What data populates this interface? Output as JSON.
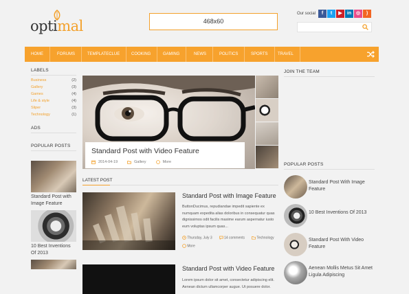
{
  "header": {
    "logo_part1": "opti",
    "logo_part2": "mal",
    "ad_text": "468x60",
    "social_label": "Our social",
    "social_icons": [
      {
        "name": "facebook-icon",
        "glyph": "f",
        "color": "#3b5998"
      },
      {
        "name": "twitter-icon",
        "glyph": "t",
        "color": "#1da1f2"
      },
      {
        "name": "youtube-icon",
        "glyph": "▶",
        "color": "#cc2127"
      },
      {
        "name": "linkedin-icon",
        "glyph": "in",
        "color": "#0077b5"
      },
      {
        "name": "dribbble-icon",
        "glyph": "◎",
        "color": "#ea4c89"
      },
      {
        "name": "rss-icon",
        "glyph": ")",
        "color": "#f26522"
      }
    ],
    "accent": "#f7a22d"
  },
  "nav": {
    "items": [
      "HOME",
      "FORUMS",
      "TEMPLATECLUE",
      "COOKING",
      "GAMING",
      "NEWS",
      "POLITICS",
      "SPORTS",
      "TRAVEL"
    ]
  },
  "left_sidebar": {
    "labels_title": "LABELS",
    "labels": [
      {
        "name": "Business",
        "count": "(2)"
      },
      {
        "name": "Gallery",
        "count": "(3)"
      },
      {
        "name": "Games",
        "count": "(4)"
      },
      {
        "name": "Life & style",
        "count": "(4)"
      },
      {
        "name": "Sliper",
        "count": "(3)"
      },
      {
        "name": "Technology",
        "count": "(1)"
      }
    ],
    "ads_title": "ADS",
    "popular_title": "POPULAR POSTS",
    "popular": [
      {
        "title": "Standard Post with Image Feature"
      },
      {
        "title": "10 Best Inventions Of 2013"
      }
    ]
  },
  "slider": {
    "title": "Standard Post with Video Feature",
    "date": "2014-04-19",
    "category": "Gallery",
    "more": "More"
  },
  "latest": {
    "section_title": "LATEST POST",
    "posts": [
      {
        "title": "Standard Post with Image Feature",
        "excerpt": "ButtonDucimus, repudiandae impedit sapiente ex numquam expedita alias doloribus in consequatur quas dignissimos odit facilis maxime earum aspernatur iusto eum voluptas ipsum quas...",
        "date": "Thursday, July 3",
        "comments": "14 comments",
        "category": "Technology",
        "more": "More"
      },
      {
        "title": "Standard Post with Video Feature",
        "excerpt": "Lorem ipsum dolor sit amet, consectetur adipiscing elit. Aenean dictum ullamcorper augue. Ut posuere dolor."
      }
    ]
  },
  "right_sidebar": {
    "join_title": "JOIN THE TEAM",
    "popular_title": "POPULAR POSTS",
    "popular": [
      {
        "title": "Standard Post With Image Feature"
      },
      {
        "title": "10 Best Inventions Of 2013"
      },
      {
        "title": "Standard Post With Video Feature"
      },
      {
        "title": "Aenean Mollis Metus Sit Amet Ligula Adipiscing"
      }
    ]
  }
}
